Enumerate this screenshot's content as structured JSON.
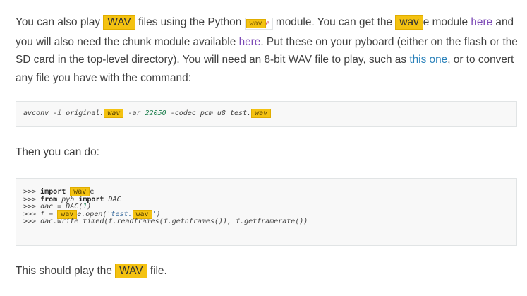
{
  "para1": {
    "t1": "You can also play ",
    "hl1": "WAV",
    "t2": " files using the Python ",
    "code_hl": "wav",
    "code_rest": "e",
    "t3": " module. You can get the ",
    "hl2": "wav",
    "t4": "e module ",
    "link1": "here",
    "t5": " and you will also need the chunk module available ",
    "link2": "here",
    "t6": ". Put these on your pyboard (either on the flash or the SD card in the top-level directory). You will need an 8-bit WAV file to play, such as ",
    "link3": "this one",
    "t7": ", or to convert any file you have with the command:"
  },
  "code1": {
    "a": "avconv -i original.",
    "hl1": "wav",
    "b": " -ar ",
    "num": "22050",
    "c": " -codec pcm_u8 test.",
    "hl2": "wav"
  },
  "para2": {
    "text": "Then you can do:"
  },
  "code2": {
    "prompt": ">>> ",
    "l1_kw": "import",
    "l1_hl": "wav",
    "l1_rest": "e",
    "l2_kw1": "from",
    "l2_mod": "pyb",
    "l2_kw2": "import",
    "l2_name": "DAC",
    "l3_a": "dac = DAC(",
    "l3_num": "1",
    "l3_b": ")",
    "l4_a": "f = ",
    "l4_hl1": "wav",
    "l4_b": "e.open(",
    "l4_str_a": "'test.",
    "l4_hl2": "wav",
    "l4_str_b": "'",
    "l4_c": ")",
    "l5": "dac.write_timed(f.readframes(f.getnframes()), f.getframerate())"
  },
  "para3": {
    "t1": "This should play the ",
    "hl": "WAV",
    "t2": " file."
  },
  "colors": {
    "highlight": "#f4c211",
    "link_visited": "#7b49b5",
    "link": "#2980b9",
    "inline_code": "#c7254e"
  }
}
